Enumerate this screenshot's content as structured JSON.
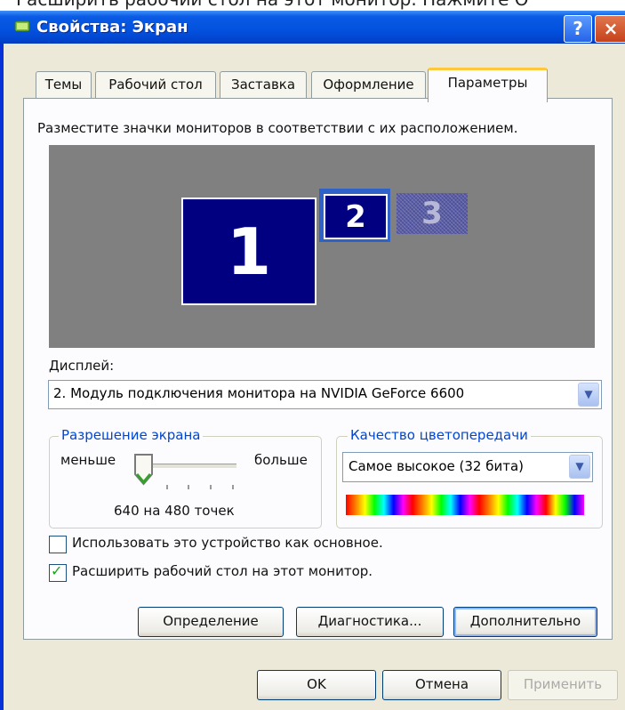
{
  "caption_top": "Расширить рабочий стол на этот монитор. Нажмите О",
  "window": {
    "title": "Свойства: Экран",
    "help_label": "?",
    "close_label": "×"
  },
  "tabs": [
    {
      "label": "Темы"
    },
    {
      "label": "Рабочий стол"
    },
    {
      "label": "Заставка"
    },
    {
      "label": "Оформление"
    },
    {
      "label": "Параметры",
      "active": true
    }
  ],
  "settings": {
    "instruction": "Разместите значки мониторов в соответствии с их расположением.",
    "monitors": [
      {
        "number": "1",
        "state": "primary"
      },
      {
        "number": "2",
        "state": "selected"
      },
      {
        "number": "3",
        "state": "disabled"
      }
    ],
    "display_label": "Дисплей:",
    "display_value": "2. Модуль подключения монитора на NVIDIA GeForce 6600",
    "resolution": {
      "legend": "Разрешение экрана",
      "less_label": "меньше",
      "more_label": "больше",
      "value_text": "640 на 480 точек",
      "slider_position": 0
    },
    "color_quality": {
      "legend": "Качество цветопередачи",
      "value": "Самое высокое (32 бита)"
    },
    "checkbox_primary": {
      "label": "Использовать это устройство как основное.",
      "checked": false
    },
    "checkbox_extend": {
      "label": "Расширить рабочий стол на этот монитор.",
      "checked": true
    },
    "buttons": {
      "identify": "Определение",
      "troubleshoot": "Диагностика...",
      "advanced": "Дополнительно"
    }
  },
  "footer": {
    "ok": "OK",
    "cancel": "Отмена",
    "apply": "Применить"
  },
  "colors": {
    "titlebar": "#0353e0",
    "dialog_bg": "#ece9d8",
    "monitor_bg": "#010080",
    "legend_text": "#0046d5"
  }
}
